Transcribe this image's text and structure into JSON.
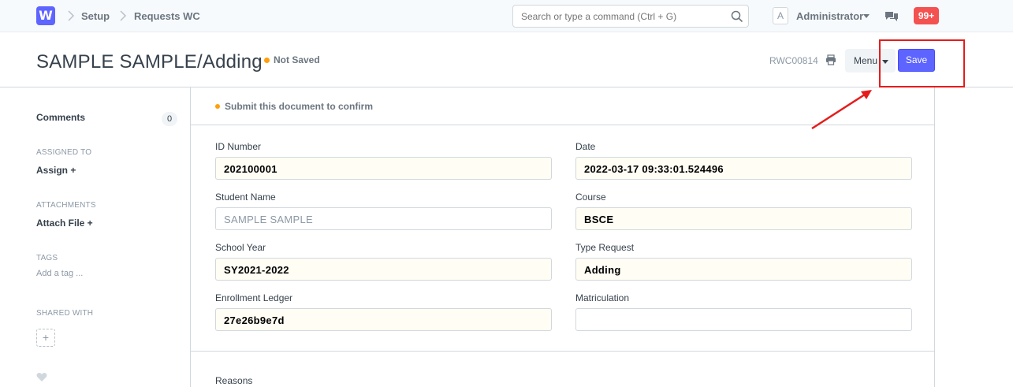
{
  "navbar": {
    "logo_letter": "W",
    "breadcrumbs": [
      "Setup",
      "Requests WC"
    ],
    "search_placeholder": "Search or type a command (Ctrl + G)",
    "avatar_letter": "A",
    "user_name": "Administrator",
    "notification_count": "99+"
  },
  "header": {
    "title": "SAMPLE SAMPLE/Adding",
    "status": "Not Saved",
    "doc_id": "RWC00814",
    "menu_label": "Menu",
    "save_label": "Save"
  },
  "sidebar": {
    "comments_label": "Comments",
    "comments_count": "0",
    "assigned_to_label": "ASSIGNED TO",
    "assign_label": "Assign +",
    "attachments_label": "ATTACHMENTS",
    "attach_label": "Attach File +",
    "tags_label": "TAGS",
    "add_tag_label": "Add a tag ...",
    "shared_with_label": "SHARED WITH",
    "share_add": "+"
  },
  "form": {
    "message": "Submit this document to confirm",
    "fields": {
      "id_number": {
        "label": "ID Number",
        "value": "202100001"
      },
      "date": {
        "label": "Date",
        "value": "2022-03-17 09:33:01.524496"
      },
      "student_name": {
        "label": "Student Name",
        "value": "SAMPLE SAMPLE"
      },
      "course": {
        "label": "Course",
        "value": "BSCE"
      },
      "school_year": {
        "label": "School Year",
        "value": "SY2021-2022"
      },
      "type_request": {
        "label": "Type Request",
        "value": "Adding"
      },
      "enrollment_ledger": {
        "label": "Enrollment Ledger",
        "value": "27e26b9e7d"
      },
      "matriculation": {
        "label": "Matriculation",
        "value": ""
      }
    },
    "reasons_label": "Reasons"
  },
  "colors": {
    "primary": "#5e64ff",
    "indicator_orange": "#ffa00a",
    "badge_red": "#f45151",
    "annotation_red": "#e51c1c"
  }
}
